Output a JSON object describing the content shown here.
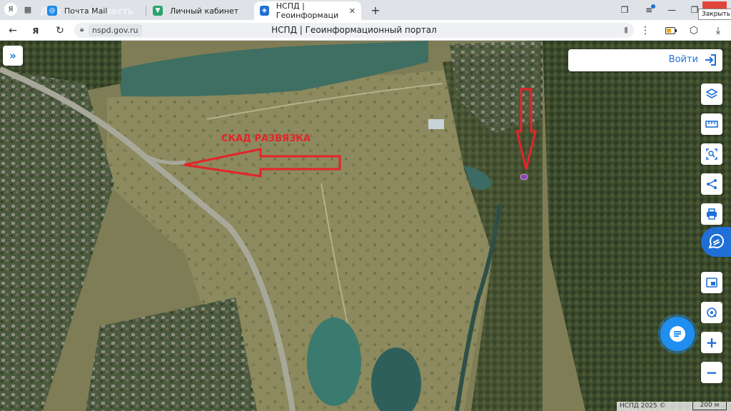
{
  "browser": {
    "ghost_text": "Для нового ласть",
    "tabs": [
      {
        "label": "Почта Mail",
        "icon": "mail-icon",
        "active": false
      },
      {
        "label": "Личный кабинет",
        "icon": "shield-icon",
        "active": false
      },
      {
        "label": "НСПД | Геоинформаци",
        "icon": "nspd-icon",
        "active": true
      }
    ],
    "close_tooltip": "Закрыть",
    "domain": "nspd.gov.ru",
    "page_title": "НСПД | Геоинформационный портал"
  },
  "map": {
    "annotation": "СКАД РАЗВЯЗКА",
    "login_label": "Войти",
    "copyright": "НСПД 2025 ©",
    "scale": "200 м",
    "colors": {
      "accent": "#1f6fd6",
      "arrow": "#e5242b",
      "marker": "#8e44ad"
    },
    "controls": [
      "layers-icon",
      "ruler-icon",
      "select-area-icon",
      "share-icon",
      "print-icon",
      "assistant-icon",
      "minimap-icon",
      "location-icon",
      "zoom-in",
      "zoom-out"
    ],
    "zoom_in_label": "+",
    "zoom_out_label": "−"
  }
}
